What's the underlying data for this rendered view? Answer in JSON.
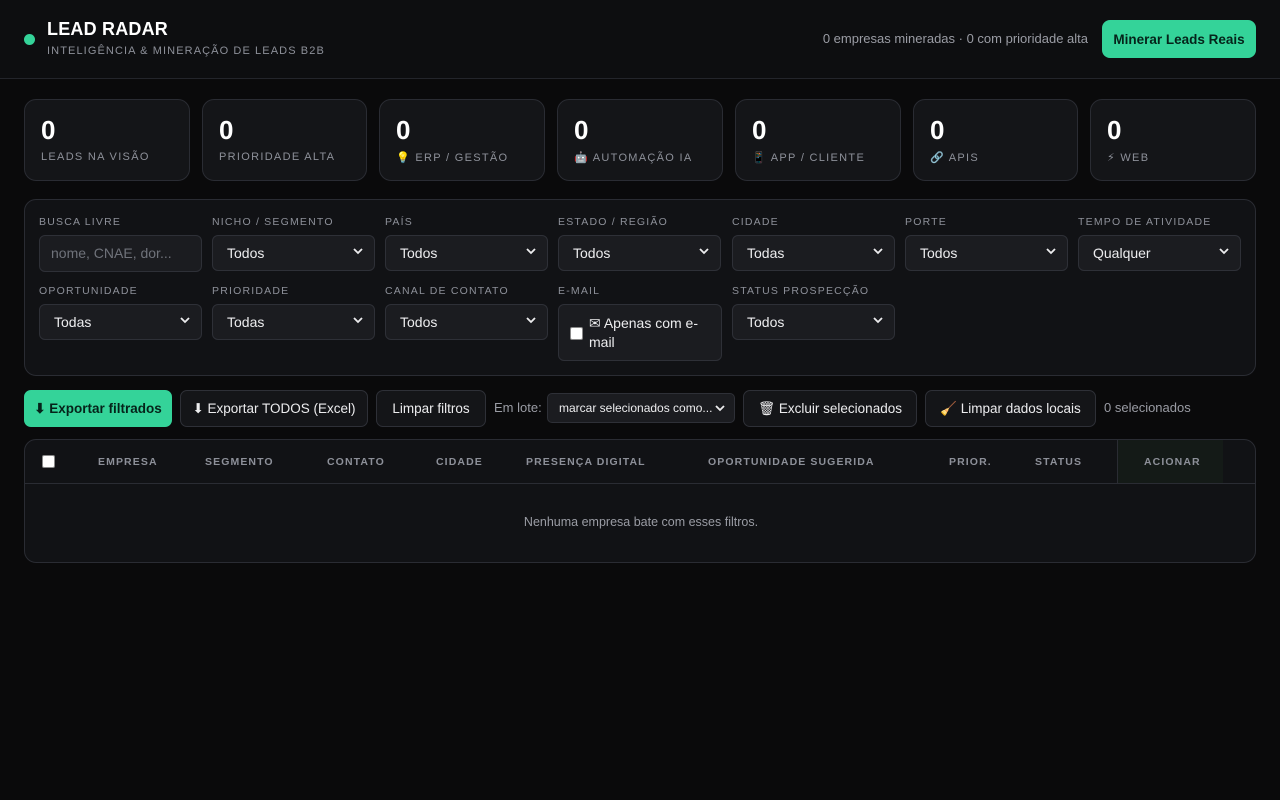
{
  "header": {
    "title": "LEAD RADAR",
    "subtitle": "INTELIGÊNCIA & MINERAÇÃO DE LEADS B2B",
    "status": "0 empresas mineradas · 0 com prioridade alta",
    "mine_button": "Minerar Leads Reais",
    "accent_color": "#34d399"
  },
  "stats": [
    {
      "value": "0",
      "label": "LEADS NA VISÃO",
      "icon": ""
    },
    {
      "value": "0",
      "label": "PRIORIDADE ALTA",
      "icon": ""
    },
    {
      "value": "0",
      "label": "💡 ERP / GESTÃO",
      "icon": "lightbulb-icon"
    },
    {
      "value": "0",
      "label": "🤖 AUTOMAÇÃO IA",
      "icon": "robot-icon"
    },
    {
      "value": "0",
      "label": "📱 APP / CLIENTE",
      "icon": "phone-icon"
    },
    {
      "value": "0",
      "label": "🔗 APIS",
      "icon": "link-icon"
    },
    {
      "value": "0",
      "label": "⚡ WEB",
      "icon": "lightning-icon"
    }
  ],
  "filters": {
    "search": {
      "label": "BUSCA LIVRE",
      "placeholder": "nome, CNAE, dor..."
    },
    "niche": {
      "label": "NICHO / SEGMENTO",
      "value": "Todos"
    },
    "country": {
      "label": "PAÍS",
      "value": "Todos"
    },
    "state": {
      "label": "ESTADO / REGIÃO",
      "value": "Todos"
    },
    "city": {
      "label": "CIDADE",
      "value": "Todas"
    },
    "size": {
      "label": "PORTE",
      "value": "Todos"
    },
    "activity_time": {
      "label": "TEMPO DE ATIVIDADE",
      "value": "Qualquer"
    },
    "opportunity": {
      "label": "OPORTUNIDADE",
      "value": "Todas"
    },
    "priority": {
      "label": "PRIORIDADE",
      "value": "Todas"
    },
    "channel": {
      "label": "CANAL DE CONTATO",
      "value": "Todos"
    },
    "email": {
      "label": "E-MAIL",
      "checkbox_label": "✉ Apenas com e-mail"
    },
    "status": {
      "label": "STATUS PROSPECÇÃO",
      "value": "Todos"
    }
  },
  "actions": {
    "export_filtered": "⬇ Exportar filtrados",
    "export_all": "⬇ Exportar TODOS (Excel)",
    "clear_filters": "Limpar filtros",
    "batch_label": "Em lote:",
    "batch_select": "marcar selecionados como...",
    "delete_selected": "🗑 Excluir selecionados",
    "clear_local": "🧹 Limpar dados locais",
    "selected_count": "0 selecionados"
  },
  "table": {
    "columns": [
      "EMPRESA",
      "SEGMENTO",
      "CONTATO",
      "CIDADE",
      "PRESENÇA DIGITAL",
      "OPORTUNIDADE SUGERIDA",
      "PRIOR.",
      "STATUS",
      "ACIONAR"
    ],
    "rows": [],
    "empty_message": "Nenhuma empresa bate com esses filtros."
  }
}
